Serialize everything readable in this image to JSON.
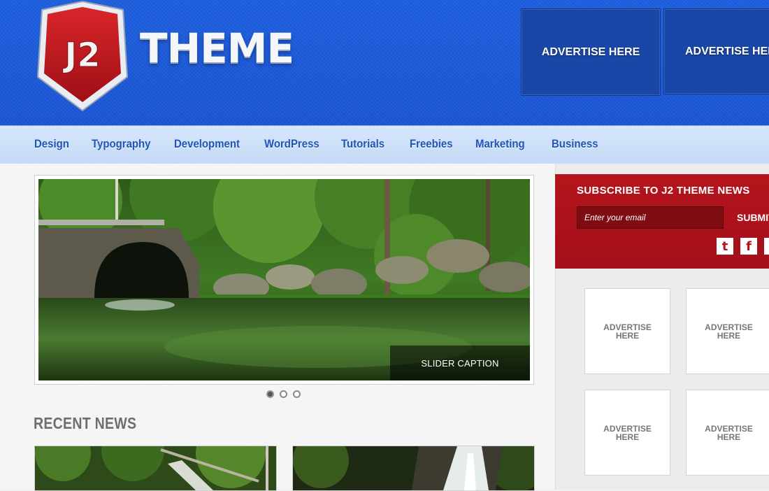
{
  "header": {
    "logo_badge_text": "J2",
    "logo_text": "THEME",
    "ads": [
      "ADVERTISE HERE",
      "ADVERTISE HERE"
    ]
  },
  "nav": {
    "items": [
      "Design",
      "Typography",
      "Development",
      "WordPress",
      "Tutorials",
      "Freebies",
      "Marketing",
      "Business"
    ]
  },
  "slider": {
    "caption": "SLIDER CAPTION",
    "slide_count": 3,
    "active_slide": 1
  },
  "recent_news": {
    "title": "RECENT NEWS"
  },
  "subscribe": {
    "title": "SUBSCRIBE TO J2 THEME NEWS",
    "email_placeholder": "Enter your email",
    "submit_label": "SUBMIT",
    "social": [
      {
        "name": "twitter-icon",
        "glyph": "t"
      },
      {
        "name": "facebook-icon",
        "glyph": "f"
      }
    ]
  },
  "sidebar_ads": [
    "ADVERTISE\nHERE",
    "ADVERTISE\nHERE",
    "ADVERTISE\nHERE",
    "ADVERTISE\nHERE"
  ],
  "colors": {
    "header_blue": "#1d5fe0",
    "nav_text": "#1f55b8",
    "subscribe_red": "#b5141c"
  }
}
